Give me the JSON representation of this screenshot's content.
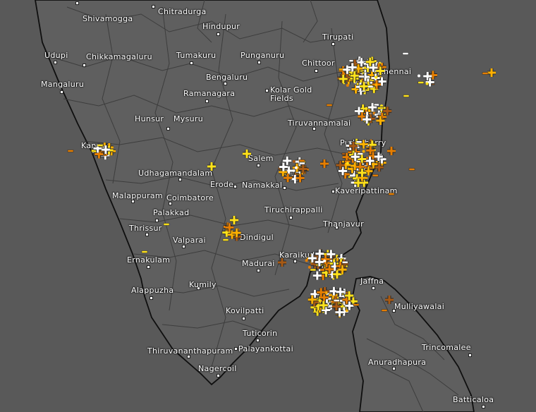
{
  "map": {
    "background_color": "#5d5d5d",
    "land_color": "#5e5e5e",
    "sea_color": "#595959",
    "boundary_color": "#3c3c3c",
    "coast_color": "#111111"
  },
  "cities": [
    {
      "id": "shivamogga",
      "name": "Shivamogga"
    },
    {
      "id": "chitradurga",
      "name": "Chitradurga"
    },
    {
      "id": "hindupur",
      "name": "Hindupur"
    },
    {
      "id": "tirupati",
      "name": "Tirupati"
    },
    {
      "id": "udupi",
      "name": "Udupi"
    },
    {
      "id": "chikkamagaluru",
      "name": "Chikkamagaluru"
    },
    {
      "id": "tumakuru",
      "name": "Tumakuru"
    },
    {
      "id": "punganuru",
      "name": "Punganuru"
    },
    {
      "id": "chittoor",
      "name": "Chittoor"
    },
    {
      "id": "chennai",
      "name": "Chennai"
    },
    {
      "id": "bengaluru",
      "name": "Bengaluru"
    },
    {
      "id": "mangaluru",
      "name": "Mangaluru"
    },
    {
      "id": "ramanagara",
      "name": "Ramanagara"
    },
    {
      "id": "kolar-gold-fields",
      "name": "Kolar Gold\nFields"
    },
    {
      "id": "hunsur",
      "name": "Hunsur"
    },
    {
      "id": "mysuru",
      "name": "Mysuru"
    },
    {
      "id": "tiruvannamalai",
      "name": "Tiruvannamalai"
    },
    {
      "id": "kannur",
      "name": "Kannur"
    },
    {
      "id": "puducherry",
      "name": "Puducherry"
    },
    {
      "id": "salem",
      "name": "Salem"
    },
    {
      "id": "udhagamandalam",
      "name": "Udhagamandalam"
    },
    {
      "id": "erode",
      "name": "Erode"
    },
    {
      "id": "namakkal",
      "name": "Namakkal"
    },
    {
      "id": "kaveripattinam",
      "name": "Kaveripattinam"
    },
    {
      "id": "malappuram",
      "name": "Malappuram"
    },
    {
      "id": "coimbatore",
      "name": "Coimbatore"
    },
    {
      "id": "tiruchirappalli",
      "name": "Tiruchirappalli"
    },
    {
      "id": "palakkad",
      "name": "Palakkad"
    },
    {
      "id": "thrissur",
      "name": "Thrissur"
    },
    {
      "id": "dindigul",
      "name": "Dindigul"
    },
    {
      "id": "thanjavur",
      "name": "Thanjavur"
    },
    {
      "id": "valparai",
      "name": "Valparai"
    },
    {
      "id": "karaikudi",
      "name": "Karaikudi"
    },
    {
      "id": "ernakulam",
      "name": "Ernakulam"
    },
    {
      "id": "madurai",
      "name": "Madurai"
    },
    {
      "id": "jaffna",
      "name": "Jaffna"
    },
    {
      "id": "alappuzha",
      "name": "Alappuzha"
    },
    {
      "id": "kumily",
      "name": "Kumily"
    },
    {
      "id": "mulliyawalai",
      "name": "Mulliyawalai"
    },
    {
      "id": "kovilpatti",
      "name": "Kovilpatti"
    },
    {
      "id": "tuticorin",
      "name": "Tuticorin"
    },
    {
      "id": "thiruvananthapuram",
      "name": "Thiruvananthapuram"
    },
    {
      "id": "palayankottai",
      "name": "Palayankottai"
    },
    {
      "id": "trincomalee",
      "name": "Trincomalee"
    },
    {
      "id": "anuradhapura",
      "name": "Anuradhapura"
    },
    {
      "id": "nagercoil",
      "name": "Nagercoil"
    },
    {
      "id": "batticaloa",
      "name": "Batticaloa"
    }
  ],
  "strike_colors": {
    "newest": "#ffffff",
    "recent": "#ffe21a",
    "mid": "#ffb000",
    "older": "#e67e00",
    "oldest": "#a85a14"
  },
  "strike_symbols": {
    "positive": "plus-icon",
    "negative": "minus-icon",
    "cloud_to_cloud": "dot-icon"
  }
}
